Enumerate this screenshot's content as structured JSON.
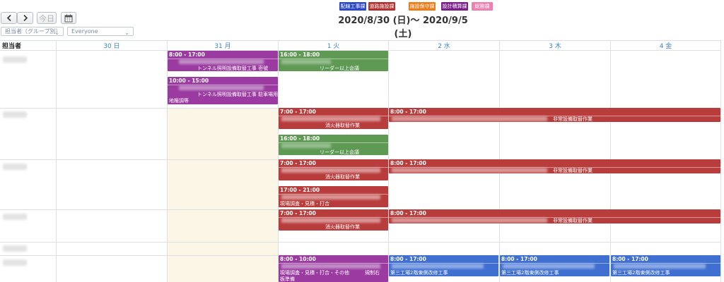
{
  "toolbar": {
    "prev_icon": "chevron-left-icon",
    "next_icon": "chevron-right-icon",
    "today_label": "今日",
    "calendar_icon": "calendar-icon",
    "filter_group_value": "担当者（グループ別）",
    "filter_user_value": "Everyone"
  },
  "legend": [
    {
      "label": "配線工事課",
      "color": "#2b47c6"
    },
    {
      "label": "道路施設課",
      "color": "#b32f2f"
    },
    {
      "label": "施設保守課",
      "color": "#ee7a18"
    },
    {
      "label": "設計積算課",
      "color": "#7a1f8a"
    },
    {
      "label": "総務課",
      "color": "#ee7fb1"
    }
  ],
  "date_range": "2020/8/30 (日)～ 2020/9/5 (土)",
  "grid": {
    "assignee_header": "担当者",
    "days": [
      "30 日",
      "31 月",
      "1 火",
      "2 水",
      "3 木",
      "4 金"
    ],
    "weekend_tint": "#fbf6e6"
  },
  "events": {
    "e1": {
      "time": "8:00 - 17:00",
      "text": "トンネル照明設備取替工事 壱號"
    },
    "e2": {
      "time": "10:00 - 15:00",
      "text": "トンネル照明設備取替工事 駐車場用",
      "text2": "地権調等"
    },
    "e3": {
      "time": "16:00 - 18:00",
      "text": "リーダー以上会議"
    },
    "e4": {
      "time": "7:00 - 17:00",
      "text": "消火器取替作業"
    },
    "e5": {
      "time": "8:00 - 17:00",
      "text": "非常設備取替作業"
    },
    "e6": {
      "time": "16:00 - 18:00",
      "text": "リーダー以上会議"
    },
    "e7": {
      "time": "7:00 - 17:00",
      "text": "消火器取替作業"
    },
    "e8": {
      "time": "8:00 - 17:00",
      "text": "非常設備取替作業"
    },
    "e9": {
      "time": "17:00 - 21:00",
      "text": "現場調査・見積・打合"
    },
    "e10": {
      "time": "7:00 - 17:00",
      "text": "消火器取替作業"
    },
    "e11": {
      "time": "8:00 - 17:00",
      "text": "非常設備取替作業"
    },
    "e12": {
      "time": "8:00 - 10:00",
      "text": "現場調査・見積・打合・その他",
      "text_b": "規制右",
      "text2": "板準備"
    },
    "e13": {
      "time": "8:00 - 17:00",
      "text": "第三工場2階東側改修工事"
    },
    "e14": {
      "time": "8:00 - 17:00",
      "text": "第三工場2階東側改修工事"
    },
    "e15": {
      "time": "8:00 - 17:00",
      "text": "第三工場2階東側改修工事"
    }
  }
}
